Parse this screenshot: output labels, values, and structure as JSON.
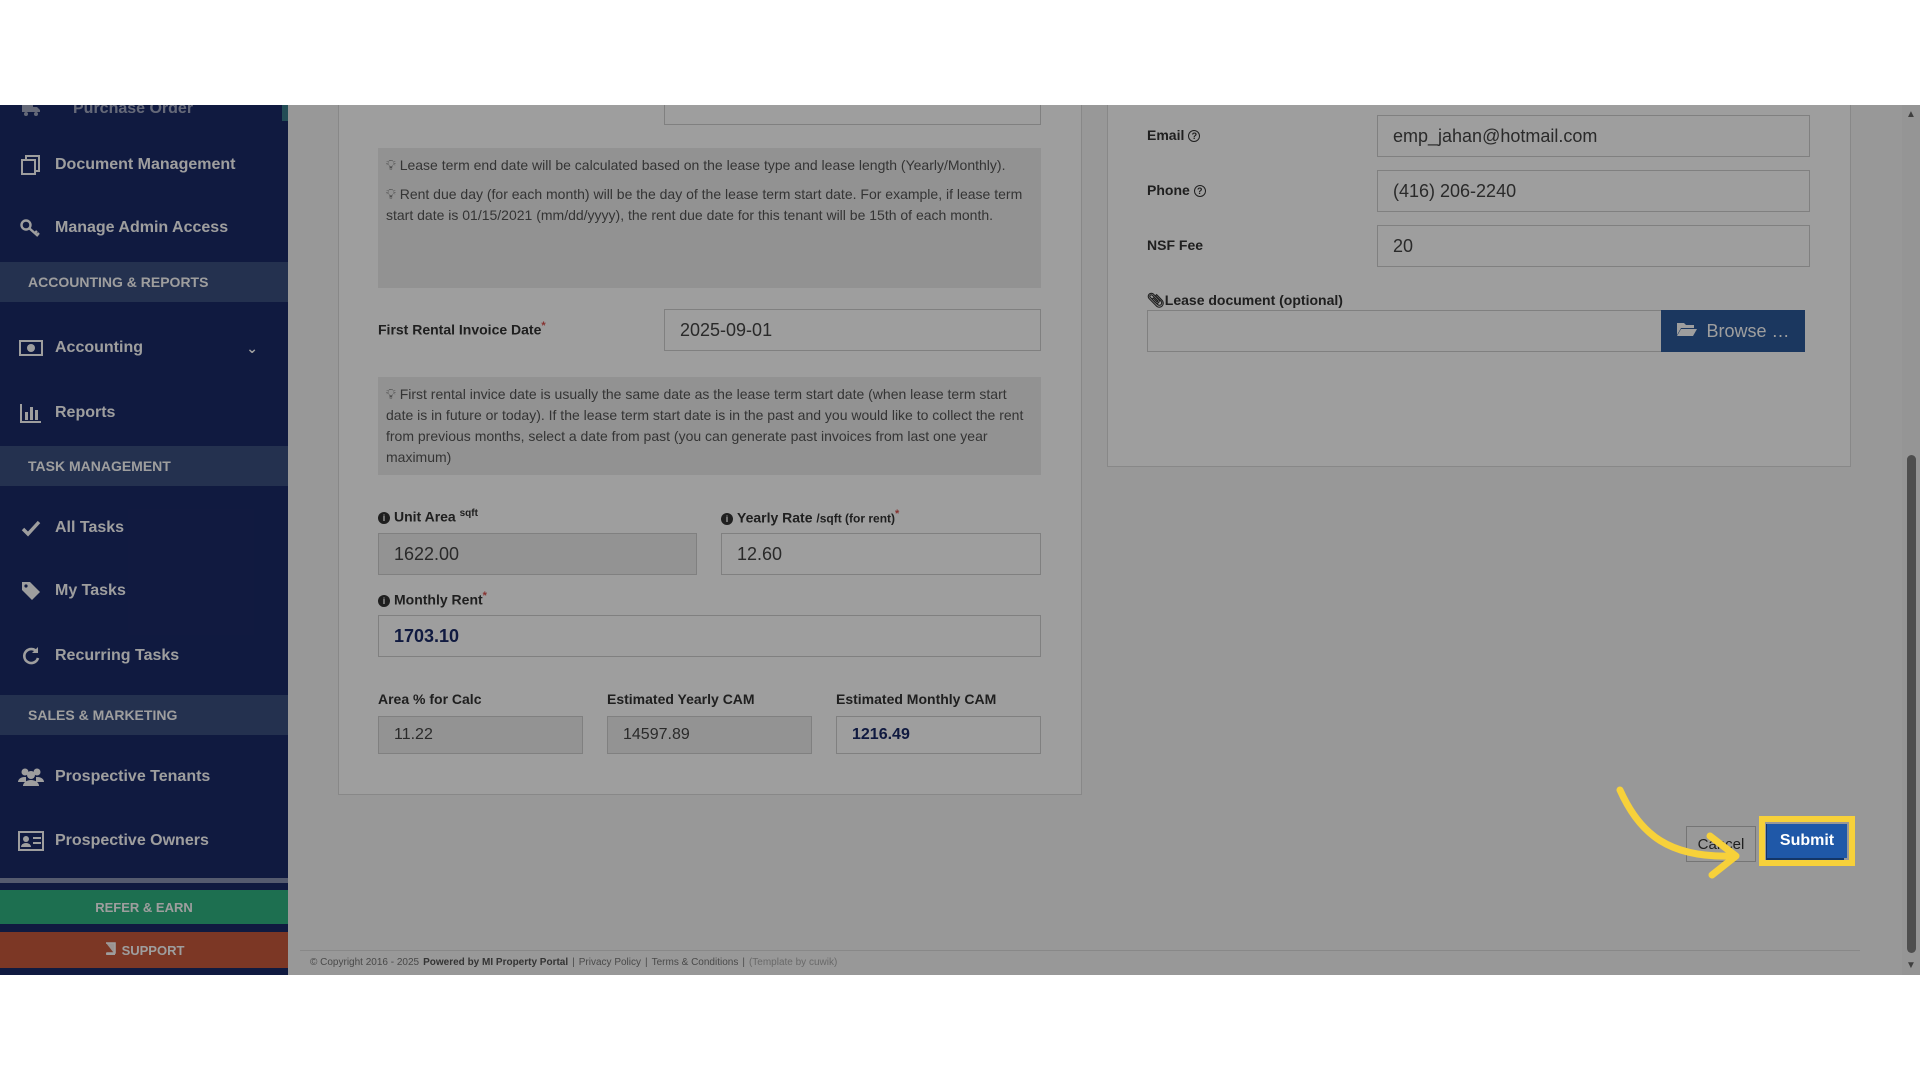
{
  "sidebar": {
    "items": [
      {
        "label": "Purchase Order",
        "icon": "truck-icon"
      },
      {
        "label": "Document Management",
        "icon": "documents-icon"
      },
      {
        "label": "Manage Admin Access",
        "icon": "key-icon"
      },
      {
        "label": "Accounting",
        "icon": "money-icon"
      },
      {
        "label": "Reports",
        "icon": "bar-chart-icon"
      },
      {
        "label": "All Tasks",
        "icon": "check-icon"
      },
      {
        "label": "My Tasks",
        "icon": "tag-icon"
      },
      {
        "label": "Recurring Tasks",
        "icon": "refresh-icon"
      },
      {
        "label": "Prospective Tenants",
        "icon": "users-icon"
      },
      {
        "label": "Prospective Owners",
        "icon": "id-card-icon"
      }
    ],
    "sections": {
      "accounting": "ACCOUNTING & REPORTS",
      "tasks": "TASK MANAGEMENT",
      "sales": "SALES & MARKETING"
    },
    "refer_label": "REFER & EARN",
    "support_label": "SUPPORT"
  },
  "lease": {
    "note_end_date": "Lease term end date will be calculated based on the lease type and lease length (Yearly/Monthly).",
    "note_rent_due": "Rent due day (for each month) will be the day of the lease term start date. For example, if lease term start date is 01/15/2021 (mm/dd/yyyy), the rent due date for this tenant will be 15th of each month.",
    "first_invoice_label": "First Rental Invoice Date",
    "first_invoice_value": "2025-09-01",
    "note_first_invoice": "First rental invice date is usually the same date as the lease term start date (when lease term start date is in future or today). If the lease term start date is in the past and you would like to collect the rent from previous months, select a date from past (you can generate past invoices from last one year maximum)",
    "unit_area_label": "Unit Area",
    "unit_area_unit": "sqft",
    "unit_area_value": "1622.00",
    "yearly_rate_label": "Yearly Rate",
    "yearly_rate_unit": "/sqft (for rent)",
    "yearly_rate_value": "12.60",
    "monthly_rent_label": "Monthly Rent",
    "monthly_rent_value": "1703.10",
    "area_pct_label": "Area % for Calc",
    "area_pct_value": "11.22",
    "yearly_cam_label": "Estimated Yearly CAM",
    "yearly_cam_value": "14597.89",
    "monthly_cam_label": "Estimated Monthly CAM",
    "monthly_cam_value": "1216.49"
  },
  "tenant": {
    "email_label": "Email",
    "email_value": "emp_jahan@hotmail.com",
    "phone_label": "Phone",
    "phone_value": "(416) 206-2240",
    "nsf_label": "NSF Fee",
    "nsf_value": "20",
    "lease_doc_label": "Lease document (optional)",
    "browse_label": "Browse …"
  },
  "actions": {
    "cancel_label": "Cancel",
    "submit_label": "Submit"
  },
  "footer": {
    "copyright": "© Copyright 2016 - 2025",
    "powered": "Powered by MI Property Portal",
    "privacy": "Privacy Policy",
    "terms": "Terms & Conditions",
    "template": "(Template by cuwik)"
  },
  "colors": {
    "sidebar_bg": "#1b2a68",
    "section_bg": "#3b4f80",
    "refer_bg": "#2fb381",
    "support_bg": "#c9593d",
    "primary_btn": "#1f58a8",
    "highlight": "#f7d13a"
  }
}
